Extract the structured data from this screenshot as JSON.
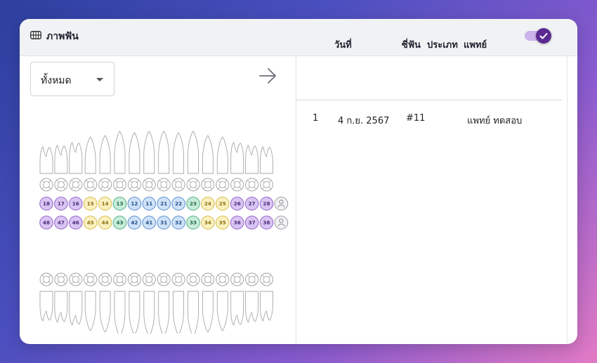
{
  "header": {
    "title": "ภาพฟัน",
    "toggle_on": true
  },
  "filter": {
    "selected": "ทั้งหมด"
  },
  "table": {
    "columns": [
      "วันที่",
      "ซี่ฟัน",
      "ประเภท",
      "แพทย์"
    ],
    "rows": [
      {
        "index": "1",
        "date": "4 ก.ย. 2567",
        "tooth": "#11",
        "type": "",
        "doctor": "แพทย์ ทดสอบ"
      }
    ]
  },
  "teeth": {
    "upper_row": [
      "18",
      "17",
      "16",
      "15",
      "14",
      "13",
      "12",
      "11",
      "21",
      "22",
      "23",
      "24",
      "25",
      "26",
      "27",
      "28"
    ],
    "lower_row": [
      "48",
      "47",
      "46",
      "45",
      "44",
      "43",
      "42",
      "41",
      "31",
      "32",
      "33",
      "34",
      "35",
      "36",
      "37",
      "38"
    ],
    "groups": [
      "molar",
      "molar",
      "molar",
      "premolar",
      "premolar",
      "canine",
      "incisor",
      "incisor",
      "incisor",
      "incisor",
      "canine",
      "premolar",
      "premolar",
      "molar",
      "molar",
      "molar"
    ]
  },
  "colors": {
    "molar": "#d9c5f2",
    "molar_stroke": "#9466cc",
    "molar_text": "#4a2a7a",
    "premolar": "#fbf1c0",
    "premolar_stroke": "#d8bc4a",
    "premolar_text": "#8a6d12",
    "canine": "#c9ecd9",
    "canine_stroke": "#4fb385",
    "canine_text": "#1c6a46",
    "incisor": "#cfe2f8",
    "incisor_stroke": "#5a8fd1",
    "incisor_text": "#1e4a86",
    "accent": "#5b2a91"
  }
}
